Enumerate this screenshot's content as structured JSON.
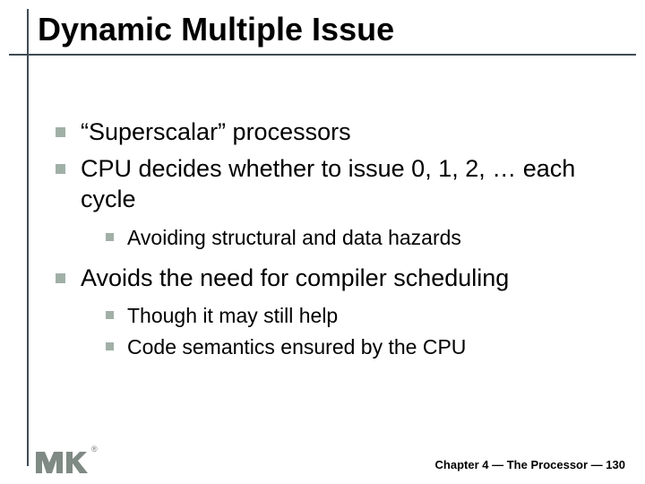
{
  "title": "Dynamic Multiple Issue",
  "bullets": {
    "b0": "“Superscalar” processors",
    "b1": "CPU decides whether to issue 0, 1, 2, … each cycle",
    "b1_sub": {
      "s0": "Avoiding structural and data hazards"
    },
    "b2": "Avoids the need for compiler scheduling",
    "b2_sub": {
      "s0": "Though it may still help",
      "s1": "Code semantics ensured by the CPU"
    }
  },
  "footer": {
    "chapter_label": "Chapter 4",
    "separator": " — ",
    "chapter_title": "The Processor",
    "page_number": "130"
  },
  "logo": {
    "name": "MK",
    "registered": "®"
  }
}
